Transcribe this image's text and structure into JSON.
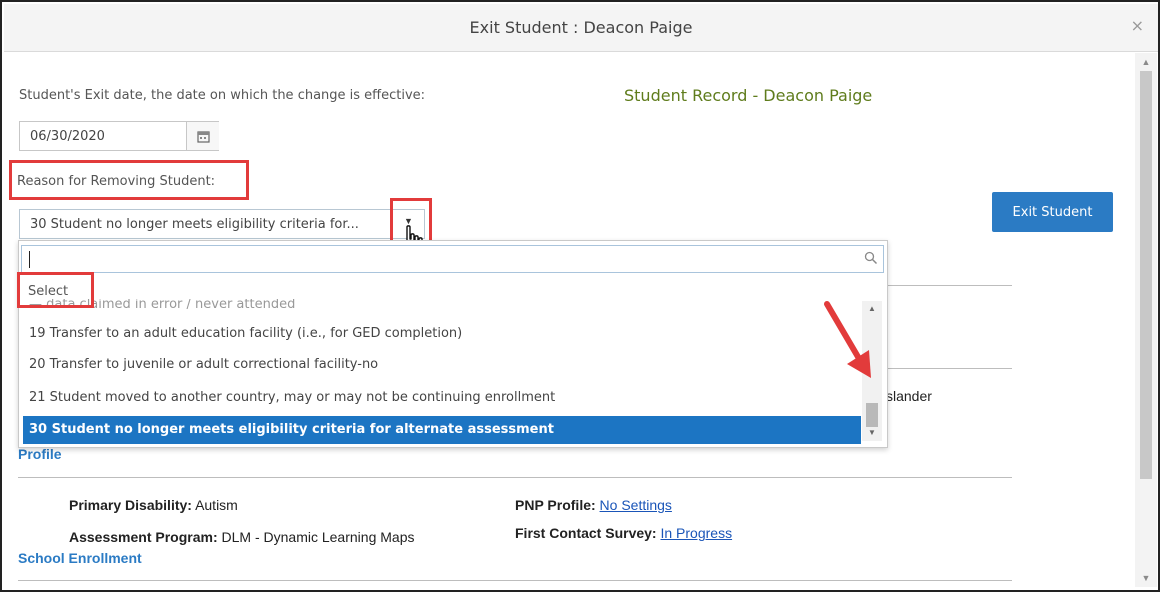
{
  "dialog": {
    "title": "Exit Student : Deacon Paige",
    "close_glyph": "×"
  },
  "form": {
    "exit_date_label": "Student's Exit date, the date on which the change is effective:",
    "exit_date_value": "06/30/2020",
    "record_title": "Student Record - Deacon Paige",
    "reason_label": "Reason for Removing Student:",
    "reason_selected": "30 Student no longer meets eligibility criteria for...",
    "exit_button": "Exit Student"
  },
  "dropdown": {
    "search_placeholder": "",
    "select_label": "Select",
    "partial_item": "— data claimed in error / never attended",
    "items": [
      "19 Transfer to an adult education facility (i.e., for GED completion)",
      "20 Transfer to juvenile or adult correctional facility-no",
      "21 Student moved to another country, may or may not be continuing enrollment",
      "30 Student no longer meets eligibility criteria for alternate assessment"
    ],
    "selected_index": 3
  },
  "background": {
    "islander_fragment": "slander",
    "profile_link": "Profile",
    "primary_disability_label": "Primary Disability:",
    "primary_disability_value": "Autism",
    "assessment_program_label": "Assessment Program:",
    "assessment_program_value": "DLM - Dynamic Learning Maps",
    "pnp_profile_label": "PNP Profile:",
    "pnp_profile_value": "No Settings",
    "first_contact_label": "First Contact Survey:",
    "first_contact_value": "In Progress",
    "school_enrollment_link": "School Enrollment"
  },
  "annotations": {
    "highlight_color": "#e23b3b",
    "arrow_color": "#e23b3b"
  },
  "colors": {
    "accent": "#2b7bc4",
    "selected_row": "#1c75c3",
    "record_title": "#5f7c1c"
  },
  "icons": [
    "calendar-icon",
    "search-icon",
    "dropdown-arrow-icon",
    "hand-cursor-icon",
    "close-icon",
    "scroll-up-icon",
    "scroll-down-icon"
  ]
}
